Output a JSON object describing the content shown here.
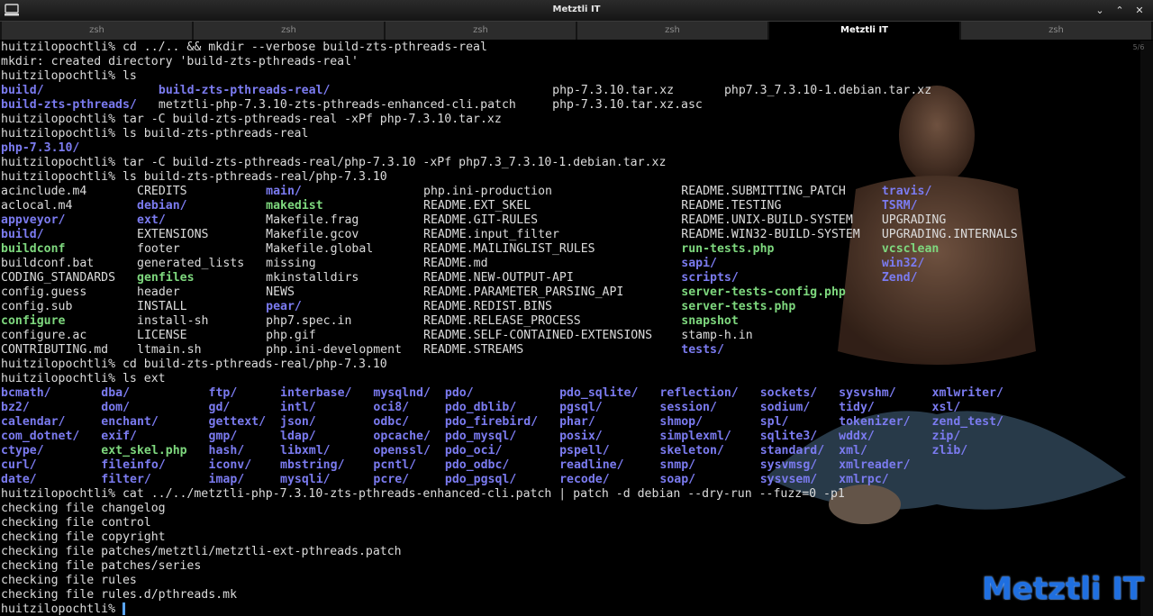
{
  "window": {
    "title": "Metztli IT"
  },
  "tabs": [
    {
      "label": "zsh",
      "active": false
    },
    {
      "label": "zsh",
      "active": false
    },
    {
      "label": "zsh",
      "active": false
    },
    {
      "label": "zsh",
      "active": false
    },
    {
      "label": "Metztli IT",
      "active": true
    },
    {
      "label": "zsh",
      "active": false
    }
  ],
  "scroll_indicator": "5/6",
  "brand_text": "Metztli IT",
  "colors": {
    "directory": "#7b7bf0",
    "executable": "#7ed87e",
    "text": "#dcdcdc",
    "brand": "#1f6fe0",
    "cursor": "#5aa6ff"
  },
  "terminal": [
    {
      "segs": [
        {
          "t": "huitzilopochtli% cd ../.. && mkdir --verbose build-zts-pthreads-real"
        }
      ]
    },
    {
      "segs": [
        {
          "t": "mkdir: created directory 'build-zts-pthreads-real'"
        }
      ]
    },
    {
      "segs": [
        {
          "t": "huitzilopochtli% ls"
        }
      ]
    },
    {
      "segs": [
        {
          "t": "build/",
          "k": "dir",
          "c": 0
        },
        {
          "t": "build-zts-pthreads-real/",
          "k": "dir",
          "c": 22
        },
        {
          "t": "php-7.3.10.tar.xz",
          "c": 77
        },
        {
          "t": "php7.3_7.3.10-1.debian.tar.xz",
          "c": 101
        }
      ]
    },
    {
      "segs": [
        {
          "t": "build-zts-pthreads/",
          "k": "dir",
          "c": 0
        },
        {
          "t": "metztli-php-7.3.10-zts-pthreads-enhanced-cli.patch",
          "c": 22
        },
        {
          "t": "php-7.3.10.tar.xz.asc",
          "c": 77
        }
      ]
    },
    {
      "segs": [
        {
          "t": "huitzilopochtli% tar -C build-zts-pthreads-real -xPf php-7.3.10.tar.xz"
        }
      ]
    },
    {
      "segs": [
        {
          "t": "huitzilopochtli% ls build-zts-pthreads-real"
        }
      ]
    },
    {
      "segs": [
        {
          "t": "php-7.3.10/",
          "k": "dir"
        }
      ]
    },
    {
      "segs": [
        {
          "t": "huitzilopochtli% tar -C build-zts-pthreads-real/php-7.3.10 -xPf php7.3_7.3.10-1.debian.tar.xz"
        }
      ]
    },
    {
      "segs": [
        {
          "t": "huitzilopochtli% ls build-zts-pthreads-real/php-7.3.10"
        }
      ]
    },
    {
      "segs": [
        {
          "t": "acinclude.m4",
          "c": 0
        },
        {
          "t": "CREDITS",
          "c": 19
        },
        {
          "t": "main/",
          "k": "dir",
          "c": 37
        },
        {
          "t": "php.ini-production",
          "c": 59
        },
        {
          "t": "README.SUBMITTING_PATCH",
          "c": 95
        },
        {
          "t": "travis/",
          "k": "dir",
          "c": 123
        }
      ]
    },
    {
      "segs": [
        {
          "t": "aclocal.m4",
          "c": 0
        },
        {
          "t": "debian/",
          "k": "dir",
          "c": 19
        },
        {
          "t": "makedist",
          "k": "exe",
          "c": 37
        },
        {
          "t": "README.EXT_SKEL",
          "c": 59
        },
        {
          "t": "README.TESTING",
          "c": 95
        },
        {
          "t": "TSRM/",
          "k": "dir",
          "c": 123
        }
      ]
    },
    {
      "segs": [
        {
          "t": "appveyor/",
          "k": "dir",
          "c": 0
        },
        {
          "t": "ext/",
          "k": "dir",
          "c": 19
        },
        {
          "t": "Makefile.frag",
          "c": 37
        },
        {
          "t": "README.GIT-RULES",
          "c": 59
        },
        {
          "t": "README.UNIX-BUILD-SYSTEM",
          "c": 95
        },
        {
          "t": "UPGRADING",
          "c": 123
        }
      ]
    },
    {
      "segs": [
        {
          "t": "build/",
          "k": "dir",
          "c": 0
        },
        {
          "t": "EXTENSIONS",
          "c": 19
        },
        {
          "t": "Makefile.gcov",
          "c": 37
        },
        {
          "t": "README.input_filter",
          "c": 59
        },
        {
          "t": "README.WIN32-BUILD-SYSTEM",
          "c": 95
        },
        {
          "t": "UPGRADING.INTERNALS",
          "c": 123
        }
      ]
    },
    {
      "segs": [
        {
          "t": "buildconf",
          "k": "exe",
          "c": 0
        },
        {
          "t": "footer",
          "c": 19
        },
        {
          "t": "Makefile.global",
          "c": 37
        },
        {
          "t": "README.MAILINGLIST_RULES",
          "c": 59
        },
        {
          "t": "run-tests.php",
          "k": "exe",
          "c": 95
        },
        {
          "t": "vcsclean",
          "k": "exe",
          "c": 123
        }
      ]
    },
    {
      "segs": [
        {
          "t": "buildconf.bat",
          "c": 0
        },
        {
          "t": "generated_lists",
          "c": 19
        },
        {
          "t": "missing",
          "c": 37
        },
        {
          "t": "README.md",
          "c": 59
        },
        {
          "t": "sapi/",
          "k": "dir",
          "c": 95
        },
        {
          "t": "win32/",
          "k": "dir",
          "c": 123
        }
      ]
    },
    {
      "segs": [
        {
          "t": "CODING_STANDARDS",
          "c": 0
        },
        {
          "t": "genfiles",
          "k": "exe",
          "c": 19
        },
        {
          "t": "mkinstalldirs",
          "c": 37
        },
        {
          "t": "README.NEW-OUTPUT-API",
          "c": 59
        },
        {
          "t": "scripts/",
          "k": "dir",
          "c": 95
        },
        {
          "t": "Zend/",
          "k": "dir",
          "c": 123
        }
      ]
    },
    {
      "segs": [
        {
          "t": "config.guess",
          "c": 0
        },
        {
          "t": "header",
          "c": 19
        },
        {
          "t": "NEWS",
          "c": 37
        },
        {
          "t": "README.PARAMETER_PARSING_API",
          "c": 59
        },
        {
          "t": "server-tests-config.php",
          "k": "exe",
          "c": 95
        }
      ]
    },
    {
      "segs": [
        {
          "t": "config.sub",
          "c": 0
        },
        {
          "t": "INSTALL",
          "c": 19
        },
        {
          "t": "pear/",
          "k": "dir",
          "c": 37
        },
        {
          "t": "README.REDIST.BINS",
          "c": 59
        },
        {
          "t": "server-tests.php",
          "k": "exe",
          "c": 95
        }
      ]
    },
    {
      "segs": [
        {
          "t": "configure",
          "k": "exe",
          "c": 0
        },
        {
          "t": "install-sh",
          "c": 19
        },
        {
          "t": "php7.spec.in",
          "c": 37
        },
        {
          "t": "README.RELEASE_PROCESS",
          "c": 59
        },
        {
          "t": "snapshot",
          "k": "exe",
          "c": 95
        }
      ]
    },
    {
      "segs": [
        {
          "t": "configure.ac",
          "c": 0
        },
        {
          "t": "LICENSE",
          "c": 19
        },
        {
          "t": "php.gif",
          "c": 37
        },
        {
          "t": "README.SELF-CONTAINED-EXTENSIONS",
          "c": 59
        },
        {
          "t": "stamp-h.in",
          "c": 95
        }
      ]
    },
    {
      "segs": [
        {
          "t": "CONTRIBUTING.md",
          "c": 0
        },
        {
          "t": "ltmain.sh",
          "c": 19
        },
        {
          "t": "php.ini-development",
          "c": 37
        },
        {
          "t": "README.STREAMS",
          "c": 59
        },
        {
          "t": "tests/",
          "k": "dir",
          "c": 95
        }
      ]
    },
    {
      "segs": [
        {
          "t": "huitzilopochtli% cd build-zts-pthreads-real/php-7.3.10"
        }
      ]
    },
    {
      "segs": [
        {
          "t": "huitzilopochtli% ls ext"
        }
      ]
    },
    {
      "segs": [
        {
          "t": "bcmath/",
          "k": "dir",
          "c": 0
        },
        {
          "t": "dba/",
          "k": "dir",
          "c": 14
        },
        {
          "t": "ftp/",
          "k": "dir",
          "c": 29
        },
        {
          "t": "interbase/",
          "k": "dir",
          "c": 39
        },
        {
          "t": "mysqlnd/",
          "k": "dir",
          "c": 52
        },
        {
          "t": "pdo/",
          "k": "dir",
          "c": 62
        },
        {
          "t": "pdo_sqlite/",
          "k": "dir",
          "c": 78
        },
        {
          "t": "reflection/",
          "k": "dir",
          "c": 92
        },
        {
          "t": "sockets/",
          "k": "dir",
          "c": 106
        },
        {
          "t": "sysvshm/",
          "k": "dir",
          "c": 117
        },
        {
          "t": "xmlwriter/",
          "k": "dir",
          "c": 130
        }
      ]
    },
    {
      "segs": [
        {
          "t": "bz2/",
          "k": "dir",
          "c": 0
        },
        {
          "t": "dom/",
          "k": "dir",
          "c": 14
        },
        {
          "t": "gd/",
          "k": "dir",
          "c": 29
        },
        {
          "t": "intl/",
          "k": "dir",
          "c": 39
        },
        {
          "t": "oci8/",
          "k": "dir",
          "c": 52
        },
        {
          "t": "pdo_dblib/",
          "k": "dir",
          "c": 62
        },
        {
          "t": "pgsql/",
          "k": "dir",
          "c": 78
        },
        {
          "t": "session/",
          "k": "dir",
          "c": 92
        },
        {
          "t": "sodium/",
          "k": "dir",
          "c": 106
        },
        {
          "t": "tidy/",
          "k": "dir",
          "c": 117
        },
        {
          "t": "xsl/",
          "k": "dir",
          "c": 130
        }
      ]
    },
    {
      "segs": [
        {
          "t": "calendar/",
          "k": "dir",
          "c": 0
        },
        {
          "t": "enchant/",
          "k": "dir",
          "c": 14
        },
        {
          "t": "gettext/",
          "k": "dir",
          "c": 29
        },
        {
          "t": "json/",
          "k": "dir",
          "c": 39
        },
        {
          "t": "odbc/",
          "k": "dir",
          "c": 52
        },
        {
          "t": "pdo_firebird/",
          "k": "dir",
          "c": 62
        },
        {
          "t": "phar/",
          "k": "dir",
          "c": 78
        },
        {
          "t": "shmop/",
          "k": "dir",
          "c": 92
        },
        {
          "t": "spl/",
          "k": "dir",
          "c": 106
        },
        {
          "t": "tokenizer/",
          "k": "dir",
          "c": 117
        },
        {
          "t": "zend_test/",
          "k": "dir",
          "c": 130
        }
      ]
    },
    {
      "segs": [
        {
          "t": "com_dotnet/",
          "k": "dir",
          "c": 0
        },
        {
          "t": "exif/",
          "k": "dir",
          "c": 14
        },
        {
          "t": "gmp/",
          "k": "dir",
          "c": 29
        },
        {
          "t": "ldap/",
          "k": "dir",
          "c": 39
        },
        {
          "t": "opcache/",
          "k": "dir",
          "c": 52
        },
        {
          "t": "pdo_mysql/",
          "k": "dir",
          "c": 62
        },
        {
          "t": "posix/",
          "k": "dir",
          "c": 78
        },
        {
          "t": "simplexml/",
          "k": "dir",
          "c": 92
        },
        {
          "t": "sqlite3/",
          "k": "dir",
          "c": 106
        },
        {
          "t": "wddx/",
          "k": "dir",
          "c": 117
        },
        {
          "t": "zip/",
          "k": "dir",
          "c": 130
        }
      ]
    },
    {
      "segs": [
        {
          "t": "ctype/",
          "k": "dir",
          "c": 0
        },
        {
          "t": "ext_skel.php",
          "k": "exe",
          "c": 14
        },
        {
          "t": "hash/",
          "k": "dir",
          "c": 29
        },
        {
          "t": "libxml/",
          "k": "dir",
          "c": 39
        },
        {
          "t": "openssl/",
          "k": "dir",
          "c": 52
        },
        {
          "t": "pdo_oci/",
          "k": "dir",
          "c": 62
        },
        {
          "t": "pspell/",
          "k": "dir",
          "c": 78
        },
        {
          "t": "skeleton/",
          "k": "dir",
          "c": 92
        },
        {
          "t": "standard/",
          "k": "dir",
          "c": 106
        },
        {
          "t": "xml/",
          "k": "dir",
          "c": 117
        },
        {
          "t": "zlib/",
          "k": "dir",
          "c": 130
        }
      ]
    },
    {
      "segs": [
        {
          "t": "curl/",
          "k": "dir",
          "c": 0
        },
        {
          "t": "fileinfo/",
          "k": "dir",
          "c": 14
        },
        {
          "t": "iconv/",
          "k": "dir",
          "c": 29
        },
        {
          "t": "mbstring/",
          "k": "dir",
          "c": 39
        },
        {
          "t": "pcntl/",
          "k": "dir",
          "c": 52
        },
        {
          "t": "pdo_odbc/",
          "k": "dir",
          "c": 62
        },
        {
          "t": "readline/",
          "k": "dir",
          "c": 78
        },
        {
          "t": "snmp/",
          "k": "dir",
          "c": 92
        },
        {
          "t": "sysvmsg/",
          "k": "dir",
          "c": 106
        },
        {
          "t": "xmlreader/",
          "k": "dir",
          "c": 117
        }
      ]
    },
    {
      "segs": [
        {
          "t": "date/",
          "k": "dir",
          "c": 0
        },
        {
          "t": "filter/",
          "k": "dir",
          "c": 14
        },
        {
          "t": "imap/",
          "k": "dir",
          "c": 29
        },
        {
          "t": "mysqli/",
          "k": "dir",
          "c": 39
        },
        {
          "t": "pcre/",
          "k": "dir",
          "c": 52
        },
        {
          "t": "pdo_pgsql/",
          "k": "dir",
          "c": 62
        },
        {
          "t": "recode/",
          "k": "dir",
          "c": 78
        },
        {
          "t": "soap/",
          "k": "dir",
          "c": 92
        },
        {
          "t": "sysvsem/",
          "k": "dir",
          "c": 106
        },
        {
          "t": "xmlrpc/",
          "k": "dir",
          "c": 117
        }
      ]
    },
    {
      "segs": [
        {
          "t": "huitzilopochtli% cat ../../metztli-php-7.3.10-zts-pthreads-enhanced-cli.patch | patch -d debian --dry-run --fuzz=0 -p1"
        }
      ]
    },
    {
      "segs": [
        {
          "t": "checking file changelog"
        }
      ]
    },
    {
      "segs": [
        {
          "t": "checking file control"
        }
      ]
    },
    {
      "segs": [
        {
          "t": "checking file copyright"
        }
      ]
    },
    {
      "segs": [
        {
          "t": "checking file patches/metztli/metztli-ext-pthreads.patch"
        }
      ]
    },
    {
      "segs": [
        {
          "t": "checking file patches/series"
        }
      ]
    },
    {
      "segs": [
        {
          "t": "checking file rules"
        }
      ]
    },
    {
      "segs": [
        {
          "t": "checking file rules.d/pthreads.mk"
        }
      ]
    },
    {
      "segs": [
        {
          "t": "huitzilopochtli% "
        }
      ],
      "cursor": true
    }
  ]
}
